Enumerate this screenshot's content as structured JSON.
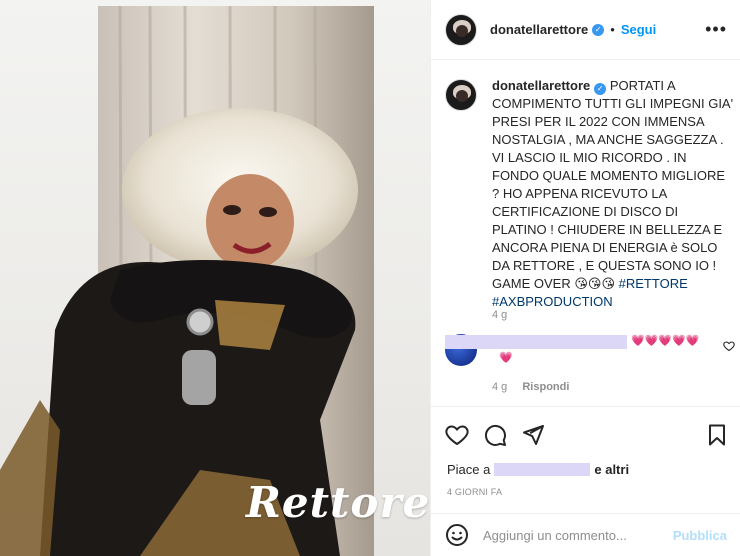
{
  "post": {
    "username": "donatellarettore",
    "follow_label": "Segui",
    "more_glyph": "•••",
    "verified_glyph": "✓",
    "separator": "•",
    "brand_logo_text": "Rettore"
  },
  "caption": {
    "username": "donatellarettore",
    "text": "PORTATI A COMPIMENTO TUTTI GLI IMPEGNI GIA' PRESI PER IL 2022 CON IMMENSA NOSTALGIA , MA ANCHE SAGGEZZA . VI LASCIO IL MIO RICORDO . IN FONDO QUALE MOMENTO MIGLIORE ? HO APPENA RICEVUTO LA CERTIFICAZIONE DI DISCO DI PLATINO ! CHIUDERE IN BELLEZZA E ANCORA PIENA DI ENERGIA è SOLO DA RETTORE , E QUESTA SONO IO ! GAME OVER 😘😘😘",
    "hashtags": "#RETTORE #AXBPRODUCTION",
    "time": "4 g"
  },
  "comment": {
    "hearts_line1": "💗💗💗💗💗",
    "hearts_line2": "💗",
    "time": "4 g",
    "reply_label": "Rispondi"
  },
  "actions": {
    "like_icon": "heart-icon",
    "comment_icon": "comment-icon",
    "share_icon": "share-icon",
    "save_icon": "bookmark-icon",
    "likes_prefix": "Piace a",
    "likes_suffix": "e altri",
    "date": "4 GIORNI FA"
  },
  "add_comment": {
    "placeholder": "Aggiungi un commento...",
    "publish_label": "Pubblica"
  },
  "colors": {
    "link_blue": "#0095f6",
    "publish_disabled": "#b2dffc",
    "hashtag": "#00376b",
    "redaction": "#dcd6f7",
    "muted": "#8e8e8e"
  }
}
